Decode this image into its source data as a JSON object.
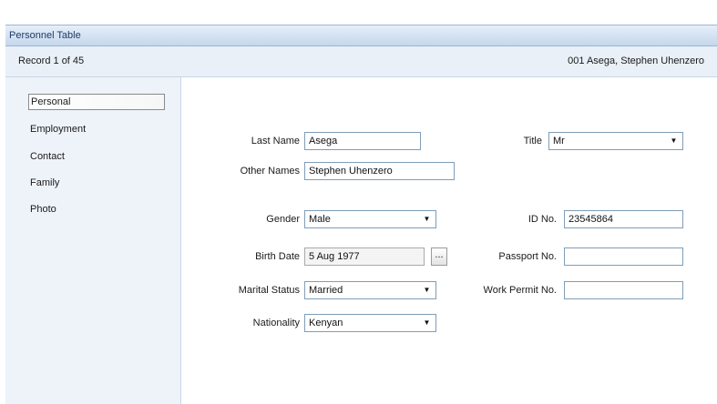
{
  "window": {
    "title": "Personnel Table"
  },
  "record_bar": {
    "position": "Record 1 of 45",
    "current_record": "001  Asega, Stephen Uhenzero"
  },
  "sidebar": {
    "items": [
      {
        "label": "Personal",
        "selected": true
      },
      {
        "label": "Employment",
        "selected": false
      },
      {
        "label": "Contact",
        "selected": false
      },
      {
        "label": "Family",
        "selected": false
      },
      {
        "label": "Photo",
        "selected": false
      }
    ]
  },
  "form": {
    "last_name": {
      "label": "Last Name",
      "value": "Asega"
    },
    "title": {
      "label": "Title",
      "value": "Mr"
    },
    "other_names": {
      "label": "Other Names",
      "value": "Stephen Uhenzero"
    },
    "gender": {
      "label": "Gender",
      "value": "Male"
    },
    "id_no": {
      "label": "ID No.",
      "value": "23545864"
    },
    "birth_date": {
      "label": "Birth Date",
      "value": "5 Aug 1977",
      "button": "..."
    },
    "passport_no": {
      "label": "Passport No.",
      "value": ""
    },
    "marital_status": {
      "label": "Marital Status",
      "value": "Married"
    },
    "work_permit_no": {
      "label": "Work Permit No.",
      "value": ""
    },
    "nationality": {
      "label": "Nationality",
      "value": "Kenyan"
    }
  },
  "icons": {
    "dropdown": "chevron-down-icon",
    "dropdown_glyph": "▼"
  }
}
